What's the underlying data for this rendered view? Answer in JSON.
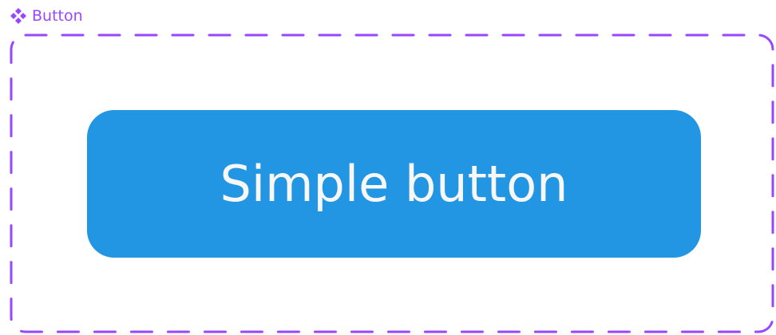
{
  "component": {
    "label": "Button",
    "icon": "component-diamond-icon",
    "accent_color": "#9747ff"
  },
  "button": {
    "label": "Simple button",
    "background_color": "#2396e3",
    "text_color": "#f7f7f7"
  }
}
